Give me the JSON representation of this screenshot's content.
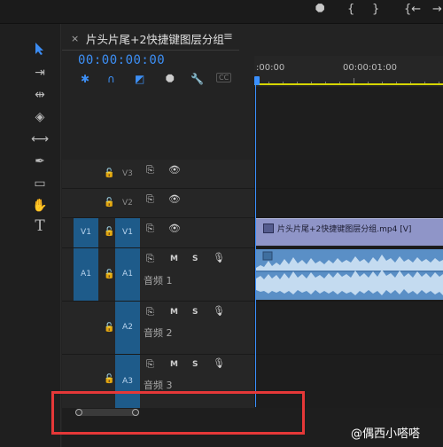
{
  "top_controls": [
    "⯃",
    "{",
    "}",
    "{←",
    "→}"
  ],
  "sequence": {
    "title": "片头片尾+2快捷键图层分组",
    "close_label": "×",
    "menu_label": "≡",
    "timecode": "00:00:00:00",
    "ruler_labels": [
      ":00:00",
      "00:00:01:00"
    ]
  },
  "timeline_icons": [
    "snap-icon",
    "linked-selection-icon",
    "add-marker-icon",
    "marker-icon",
    "wrench-icon",
    "captions-icon"
  ],
  "captions_label": "CC",
  "tools": [
    "selection-tool",
    "track-select-tool",
    "ripple-edit-tool",
    "razor-tool",
    "slip-tool",
    "pen-tool",
    "rectangle-tool",
    "hand-tool",
    "type-tool"
  ],
  "video_tracks": [
    {
      "name": "V3",
      "lock": "🔓",
      "source": ""
    },
    {
      "name": "V2",
      "lock": "🔓",
      "source": ""
    },
    {
      "name": "V1",
      "lock": "🔓",
      "source": "V1"
    }
  ],
  "audio_tracks": [
    {
      "name": "A1",
      "source": "A1",
      "label": "音频 1",
      "m": "M",
      "s": "S"
    },
    {
      "name": "A2",
      "source": "",
      "label": "音频 2",
      "m": "M",
      "s": "S"
    },
    {
      "name": "A3",
      "source": "",
      "label": "音频 3",
      "m": "M",
      "s": "S"
    }
  ],
  "video_clip_label": "片头片尾+2快捷键图层分组.mp4 [V]",
  "watermark": "@偶西小嗒嗒",
  "colors": {
    "accent": "#3d8ff5",
    "track_target": "#1e5b8a",
    "video_clip": "#8f95c8",
    "audio_clip": "#5a8fc6",
    "highlight": "#e53838"
  }
}
